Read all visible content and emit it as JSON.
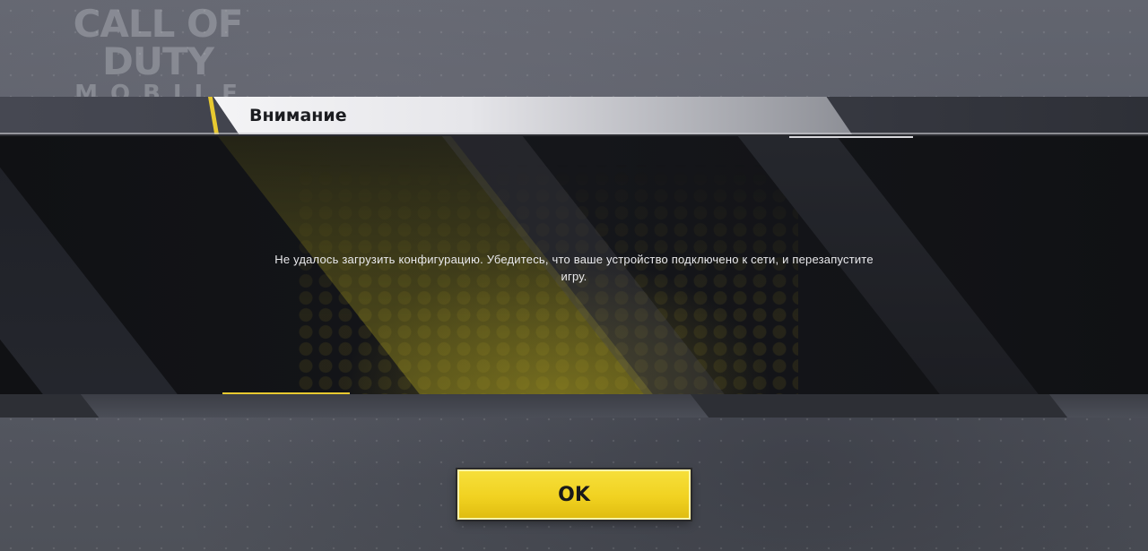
{
  "logo": {
    "line1": "CALL OF DUTY",
    "line2": "MOBILE"
  },
  "dialog": {
    "title": "Внимание",
    "message": "Не удалось загрузить конфигурацию. Убедитесь, что ваше устройство подключено к сети, и перезапустите игру.",
    "ok_label": "OK"
  },
  "colors": {
    "accent": "#e8c930",
    "button": "#f1d221",
    "band": "#121316"
  }
}
